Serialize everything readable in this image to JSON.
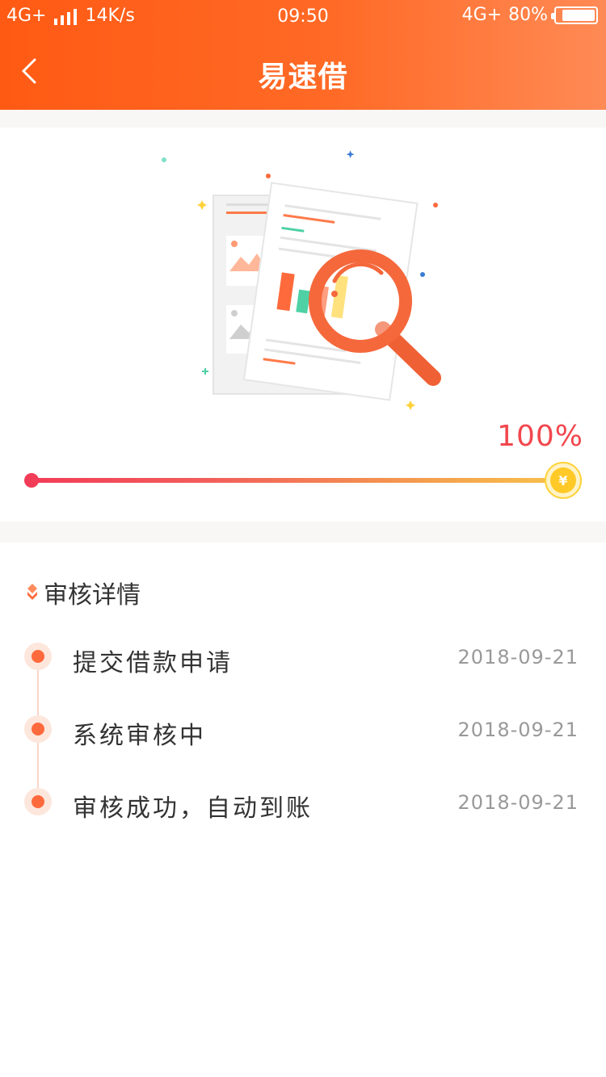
{
  "status_bar": {
    "network_left": "4G+",
    "speed": "14K/s",
    "time": "09:50",
    "network_right": "4G+",
    "battery_pct": "80%"
  },
  "nav": {
    "back_icon": "chevron-left-icon",
    "title": "易速借"
  },
  "progress": {
    "percent_text": "100%",
    "value": 1.0,
    "end_icon": "yuan-coin-icon",
    "coin_symbol": "¥",
    "gradient_start": "#f23c58",
    "gradient_end": "#f8c24a"
  },
  "detail": {
    "title": "审核详情",
    "steps": [
      {
        "label": "提交借款申请",
        "date": "2018-09-21"
      },
      {
        "label": "系统审核中",
        "date": "2018-09-21"
      },
      {
        "label": "审核成功，自动到账",
        "date": "2018-09-21"
      }
    ]
  },
  "colors": {
    "brand_orange": "#ff5a14",
    "accent_red": "#f2474e",
    "step_dot": "#ff6a3c"
  }
}
